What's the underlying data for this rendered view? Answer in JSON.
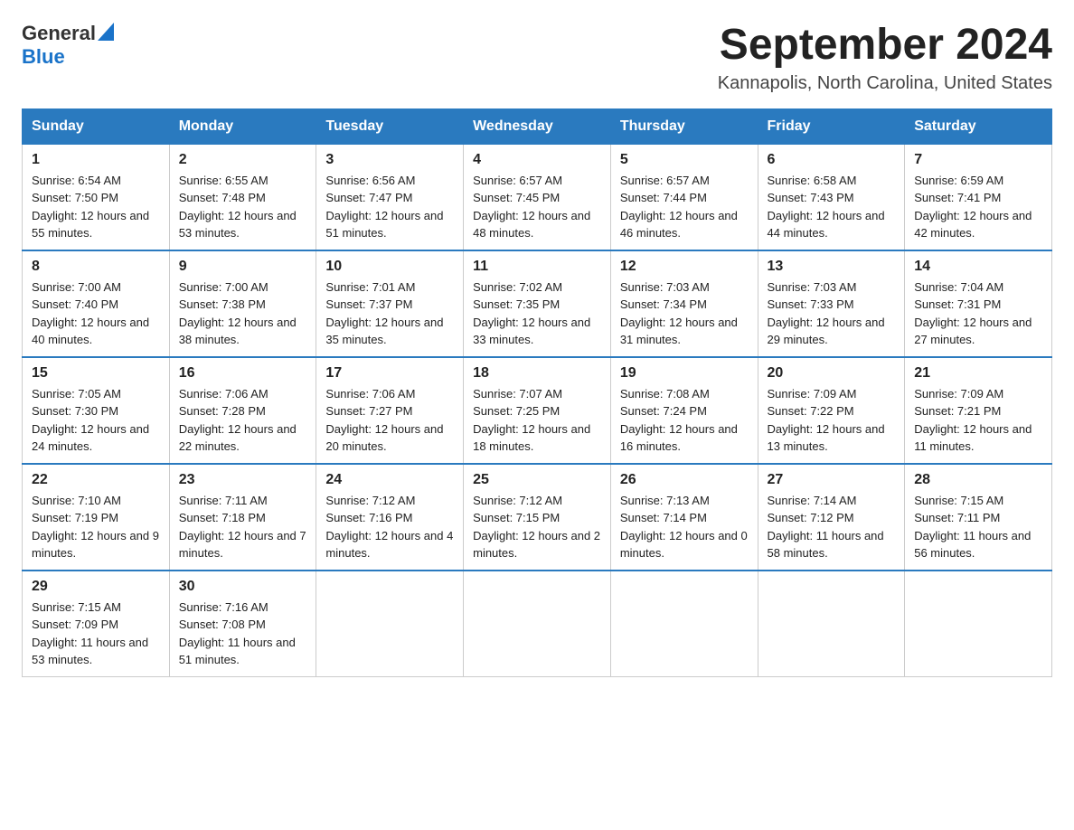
{
  "header": {
    "logo_general": "General",
    "logo_blue": "Blue",
    "month_year": "September 2024",
    "location": "Kannapolis, North Carolina, United States"
  },
  "days_of_week": [
    "Sunday",
    "Monday",
    "Tuesday",
    "Wednesday",
    "Thursday",
    "Friday",
    "Saturday"
  ],
  "weeks": [
    [
      {
        "day": "1",
        "sunrise": "6:54 AM",
        "sunset": "7:50 PM",
        "daylight": "12 hours and 55 minutes."
      },
      {
        "day": "2",
        "sunrise": "6:55 AM",
        "sunset": "7:48 PM",
        "daylight": "12 hours and 53 minutes."
      },
      {
        "day": "3",
        "sunrise": "6:56 AM",
        "sunset": "7:47 PM",
        "daylight": "12 hours and 51 minutes."
      },
      {
        "day": "4",
        "sunrise": "6:57 AM",
        "sunset": "7:45 PM",
        "daylight": "12 hours and 48 minutes."
      },
      {
        "day": "5",
        "sunrise": "6:57 AM",
        "sunset": "7:44 PM",
        "daylight": "12 hours and 46 minutes."
      },
      {
        "day": "6",
        "sunrise": "6:58 AM",
        "sunset": "7:43 PM",
        "daylight": "12 hours and 44 minutes."
      },
      {
        "day": "7",
        "sunrise": "6:59 AM",
        "sunset": "7:41 PM",
        "daylight": "12 hours and 42 minutes."
      }
    ],
    [
      {
        "day": "8",
        "sunrise": "7:00 AM",
        "sunset": "7:40 PM",
        "daylight": "12 hours and 40 minutes."
      },
      {
        "day": "9",
        "sunrise": "7:00 AM",
        "sunset": "7:38 PM",
        "daylight": "12 hours and 38 minutes."
      },
      {
        "day": "10",
        "sunrise": "7:01 AM",
        "sunset": "7:37 PM",
        "daylight": "12 hours and 35 minutes."
      },
      {
        "day": "11",
        "sunrise": "7:02 AM",
        "sunset": "7:35 PM",
        "daylight": "12 hours and 33 minutes."
      },
      {
        "day": "12",
        "sunrise": "7:03 AM",
        "sunset": "7:34 PM",
        "daylight": "12 hours and 31 minutes."
      },
      {
        "day": "13",
        "sunrise": "7:03 AM",
        "sunset": "7:33 PM",
        "daylight": "12 hours and 29 minutes."
      },
      {
        "day": "14",
        "sunrise": "7:04 AM",
        "sunset": "7:31 PM",
        "daylight": "12 hours and 27 minutes."
      }
    ],
    [
      {
        "day": "15",
        "sunrise": "7:05 AM",
        "sunset": "7:30 PM",
        "daylight": "12 hours and 24 minutes."
      },
      {
        "day": "16",
        "sunrise": "7:06 AM",
        "sunset": "7:28 PM",
        "daylight": "12 hours and 22 minutes."
      },
      {
        "day": "17",
        "sunrise": "7:06 AM",
        "sunset": "7:27 PM",
        "daylight": "12 hours and 20 minutes."
      },
      {
        "day": "18",
        "sunrise": "7:07 AM",
        "sunset": "7:25 PM",
        "daylight": "12 hours and 18 minutes."
      },
      {
        "day": "19",
        "sunrise": "7:08 AM",
        "sunset": "7:24 PM",
        "daylight": "12 hours and 16 minutes."
      },
      {
        "day": "20",
        "sunrise": "7:09 AM",
        "sunset": "7:22 PM",
        "daylight": "12 hours and 13 minutes."
      },
      {
        "day": "21",
        "sunrise": "7:09 AM",
        "sunset": "7:21 PM",
        "daylight": "12 hours and 11 minutes."
      }
    ],
    [
      {
        "day": "22",
        "sunrise": "7:10 AM",
        "sunset": "7:19 PM",
        "daylight": "12 hours and 9 minutes."
      },
      {
        "day": "23",
        "sunrise": "7:11 AM",
        "sunset": "7:18 PM",
        "daylight": "12 hours and 7 minutes."
      },
      {
        "day": "24",
        "sunrise": "7:12 AM",
        "sunset": "7:16 PM",
        "daylight": "12 hours and 4 minutes."
      },
      {
        "day": "25",
        "sunrise": "7:12 AM",
        "sunset": "7:15 PM",
        "daylight": "12 hours and 2 minutes."
      },
      {
        "day": "26",
        "sunrise": "7:13 AM",
        "sunset": "7:14 PM",
        "daylight": "12 hours and 0 minutes."
      },
      {
        "day": "27",
        "sunrise": "7:14 AM",
        "sunset": "7:12 PM",
        "daylight": "11 hours and 58 minutes."
      },
      {
        "day": "28",
        "sunrise": "7:15 AM",
        "sunset": "7:11 PM",
        "daylight": "11 hours and 56 minutes."
      }
    ],
    [
      {
        "day": "29",
        "sunrise": "7:15 AM",
        "sunset": "7:09 PM",
        "daylight": "11 hours and 53 minutes."
      },
      {
        "day": "30",
        "sunrise": "7:16 AM",
        "sunset": "7:08 PM",
        "daylight": "11 hours and 51 minutes."
      },
      null,
      null,
      null,
      null,
      null
    ]
  ],
  "labels": {
    "sunrise": "Sunrise:",
    "sunset": "Sunset:",
    "daylight": "Daylight:"
  }
}
